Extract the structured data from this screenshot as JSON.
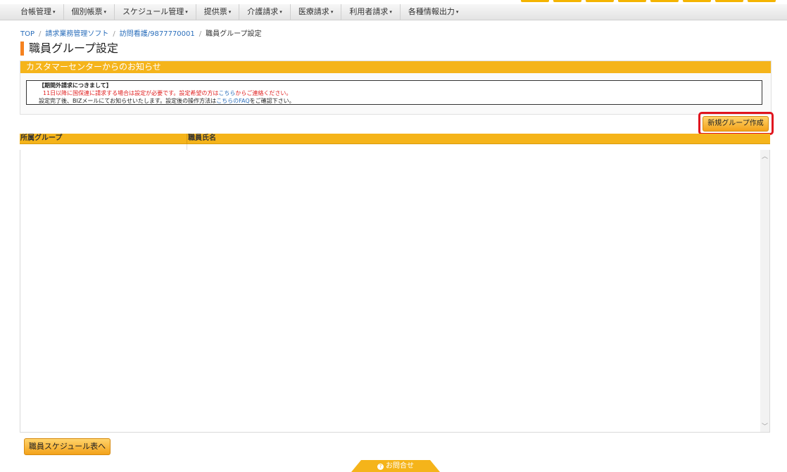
{
  "menu": {
    "items": [
      {
        "label": "台帳管理"
      },
      {
        "label": "個別帳票"
      },
      {
        "label": "スケジュール管理"
      },
      {
        "label": "提供票"
      },
      {
        "label": "介護請求"
      },
      {
        "label": "医療請求"
      },
      {
        "label": "利用者請求"
      },
      {
        "label": "各種情報出力"
      }
    ],
    "caret": "▾"
  },
  "breadcrumb": {
    "items": [
      "TOP",
      "請求業務管理ソフト",
      "訪問看護/9877770001",
      "職員グループ設定"
    ],
    "separator": "/"
  },
  "page": {
    "title": "職員グループ設定"
  },
  "notice": {
    "header": "カスタマーセンターからのお知らせ",
    "heading": "【期間外請求につきまして】",
    "line1_before": "11日以降に国保連に請求する場合は設定が必要です。設定希望の方は",
    "line1_link": "こちら",
    "line1_after": "からご連絡ください。",
    "line2_before": "設定完了後、BIZメールにてお知らせいたします。設定後の操作方法は",
    "line2_link": "こちらのFAQ",
    "line2_after": "をご確認下さい。"
  },
  "buttons": {
    "new_group": "新規グループ作成",
    "staff_schedule": "職員スケジュール表へ"
  },
  "table": {
    "columns": [
      "所属グループ",
      "職員氏名"
    ]
  },
  "contact": {
    "label": "お問合せ",
    "icon": "question-circle-icon"
  },
  "colors": {
    "accent": "#f5b41a",
    "title_bar": "#f58220",
    "highlight": "#e0141e",
    "link": "#2a6ebb",
    "warning_text": "#e02020"
  }
}
